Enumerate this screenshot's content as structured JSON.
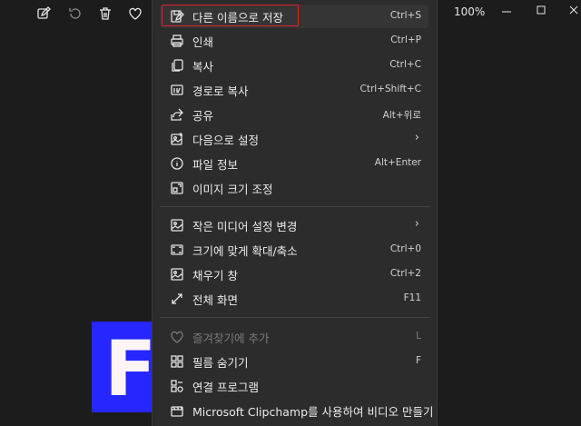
{
  "toolbar": {
    "icons": [
      "edit-icon",
      "rotate-icon",
      "delete-icon",
      "favorite-icon"
    ],
    "zoom": "100%"
  },
  "preview": {
    "letter": "F"
  },
  "menu": {
    "items": [
      {
        "id": "save-as",
        "icon": "save-as-icon",
        "label": "다른 이름으로 저장",
        "shortcut": "Ctrl+S"
      },
      {
        "id": "print",
        "icon": "print-icon",
        "label": "인쇄",
        "shortcut": "Ctrl+P"
      },
      {
        "id": "copy",
        "icon": "copy-icon",
        "label": "복사",
        "shortcut": "Ctrl+C"
      },
      {
        "id": "copy-path",
        "icon": "copy-path-icon",
        "label": "경로로 복사",
        "shortcut": "Ctrl+Shift+C"
      },
      {
        "id": "share",
        "icon": "share-icon",
        "label": "공유",
        "shortcut": "Alt+위로"
      },
      {
        "id": "set-as",
        "icon": "set-as-icon",
        "label": "다음으로 설정",
        "shortcut": "›"
      },
      {
        "id": "file-info",
        "icon": "info-icon",
        "label": "파일 정보",
        "shortcut": "Alt+Enter"
      },
      {
        "id": "resize",
        "icon": "resize-icon",
        "label": "이미지 크기 조정",
        "shortcut": ""
      },
      {
        "id": "small-media",
        "icon": "media-settings-icon",
        "label": "작은 미디어 설정 변경",
        "shortcut": "›"
      },
      {
        "id": "fit",
        "icon": "fit-icon",
        "label": "크기에 맞게 확대/축소",
        "shortcut": "Ctrl+0"
      },
      {
        "id": "fill",
        "icon": "fill-icon",
        "label": "채우기 창",
        "shortcut": "Ctrl+2"
      },
      {
        "id": "fullscreen",
        "icon": "fullscreen-icon",
        "label": "전체 화면",
        "shortcut": "F11"
      },
      {
        "id": "favorite",
        "icon": "heart-icon",
        "label": "즐겨찾기에 추가",
        "shortcut": "L",
        "disabled": true
      },
      {
        "id": "filmstrip",
        "icon": "filmstrip-icon",
        "label": "필름 숨기기",
        "shortcut": "F"
      },
      {
        "id": "open-with",
        "icon": "open-with-icon",
        "label": "연결 프로그램",
        "shortcut": ""
      },
      {
        "id": "clipchamp",
        "icon": "clipchamp-icon",
        "label": "Microsoft Clipchamp를 사용하여 비디오 만들기",
        "shortcut": ""
      }
    ]
  }
}
